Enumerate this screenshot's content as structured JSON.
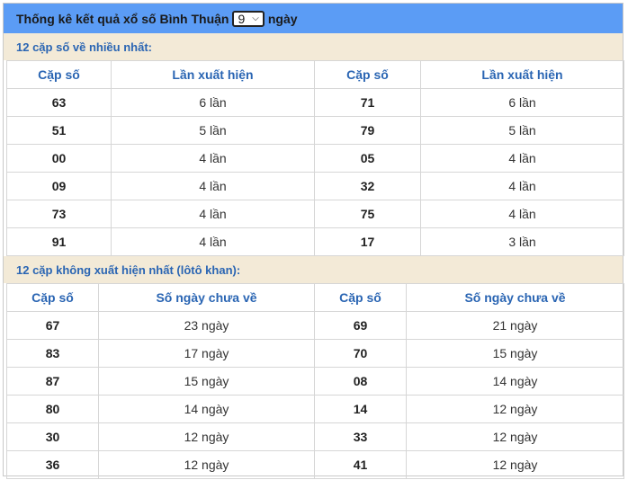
{
  "header": {
    "title_prefix": "Thống kê kết quả xổ số Bình Thuận",
    "days_value": "9",
    "title_suffix": "ngày"
  },
  "section1": {
    "title": "12 cặp số về nhiều nhất:",
    "col_pair": "Cặp số",
    "col_count": "Lần xuất hiện",
    "rows": [
      {
        "p1": "63",
        "c1": "6 lần",
        "p2": "71",
        "c2": "6 lần"
      },
      {
        "p1": "51",
        "c1": "5 lần",
        "p2": "79",
        "c2": "5 lần"
      },
      {
        "p1": "00",
        "c1": "4 lần",
        "p2": "05",
        "c2": "4 lần"
      },
      {
        "p1": "09",
        "c1": "4 lần",
        "p2": "32",
        "c2": "4 lần"
      },
      {
        "p1": "73",
        "c1": "4 lần",
        "p2": "75",
        "c2": "4 lần"
      },
      {
        "p1": "91",
        "c1": "4 lần",
        "p2": "17",
        "c2": "3 lần"
      }
    ]
  },
  "section2": {
    "title": "12 cặp không xuất hiện nhất (lôtô khan):",
    "col_pair": "Cặp số",
    "col_days": "Số ngày chưa về",
    "rows": [
      {
        "p1": "67",
        "c1": "23 ngày",
        "p2": "69",
        "c2": "21 ngày"
      },
      {
        "p1": "83",
        "c1": "17 ngày",
        "p2": "70",
        "c2": "15 ngày"
      },
      {
        "p1": "87",
        "c1": "15 ngày",
        "p2": "08",
        "c2": "14 ngày"
      },
      {
        "p1": "80",
        "c1": "14 ngày",
        "p2": "14",
        "c2": "12 ngày"
      },
      {
        "p1": "30",
        "c1": "12 ngày",
        "p2": "33",
        "c2": "12 ngày"
      },
      {
        "p1": "36",
        "c1": "12 ngày",
        "p2": "41",
        "c2": "12 ngày"
      }
    ]
  }
}
